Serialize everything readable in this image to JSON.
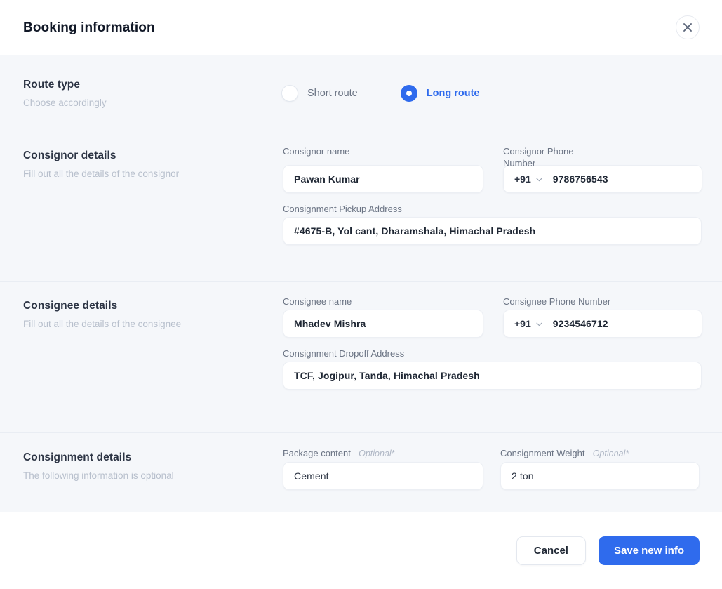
{
  "header": {
    "title": "Booking information",
    "close_icon": "close-icon"
  },
  "sections": {
    "route": {
      "title": "Route type",
      "subtitle": "Choose accordingly",
      "options": [
        {
          "label": "Short route",
          "selected": false
        },
        {
          "label": "Long route",
          "selected": true
        }
      ]
    },
    "consignor": {
      "title": "Consignor details",
      "subtitle": "Fill out all the details of the consignor",
      "name_label": "Consignor name",
      "name_value": "Pawan Kumar",
      "phone_label": "Consignor Phone Number",
      "phone_dial_code": "+91",
      "phone_value": "9786756543",
      "address_label": "Consignment Pickup Address",
      "address_value": "#4675-B, Yol cant, Dharamshala, Himachal Pradesh"
    },
    "consignee": {
      "title": "Consignee details",
      "subtitle": "Fill out all the details of the consignee",
      "name_label": "Consignee name",
      "name_value": "Mhadev Mishra",
      "phone_label": "Consignee Phone Number",
      "phone_dial_code": "+91",
      "phone_value": "9234546712",
      "address_label": "Consignment Dropoff Address",
      "address_value": "TCF, Jogipur, Tanda, Himachal Pradesh"
    },
    "consignment": {
      "title": "Consignment details",
      "subtitle": "The following information is optional",
      "package_label": "Package content",
      "package_optional": "- Optional*",
      "package_value": "Cement",
      "weight_label": "Consignment Weight",
      "weight_optional": "- Optional*",
      "weight_value": "2 ton"
    }
  },
  "footer": {
    "cancel_label": "Cancel",
    "save_label": "Save new info"
  },
  "colors": {
    "accent": "#2F6BED",
    "body_bg": "#F5F7FA",
    "surface": "#FFFFFF",
    "title_text": "#2C3444",
    "muted_text": "#B7BFCC",
    "label_text": "#6B7484",
    "value_text": "#1F2734",
    "divider": "#E9EDF3"
  }
}
